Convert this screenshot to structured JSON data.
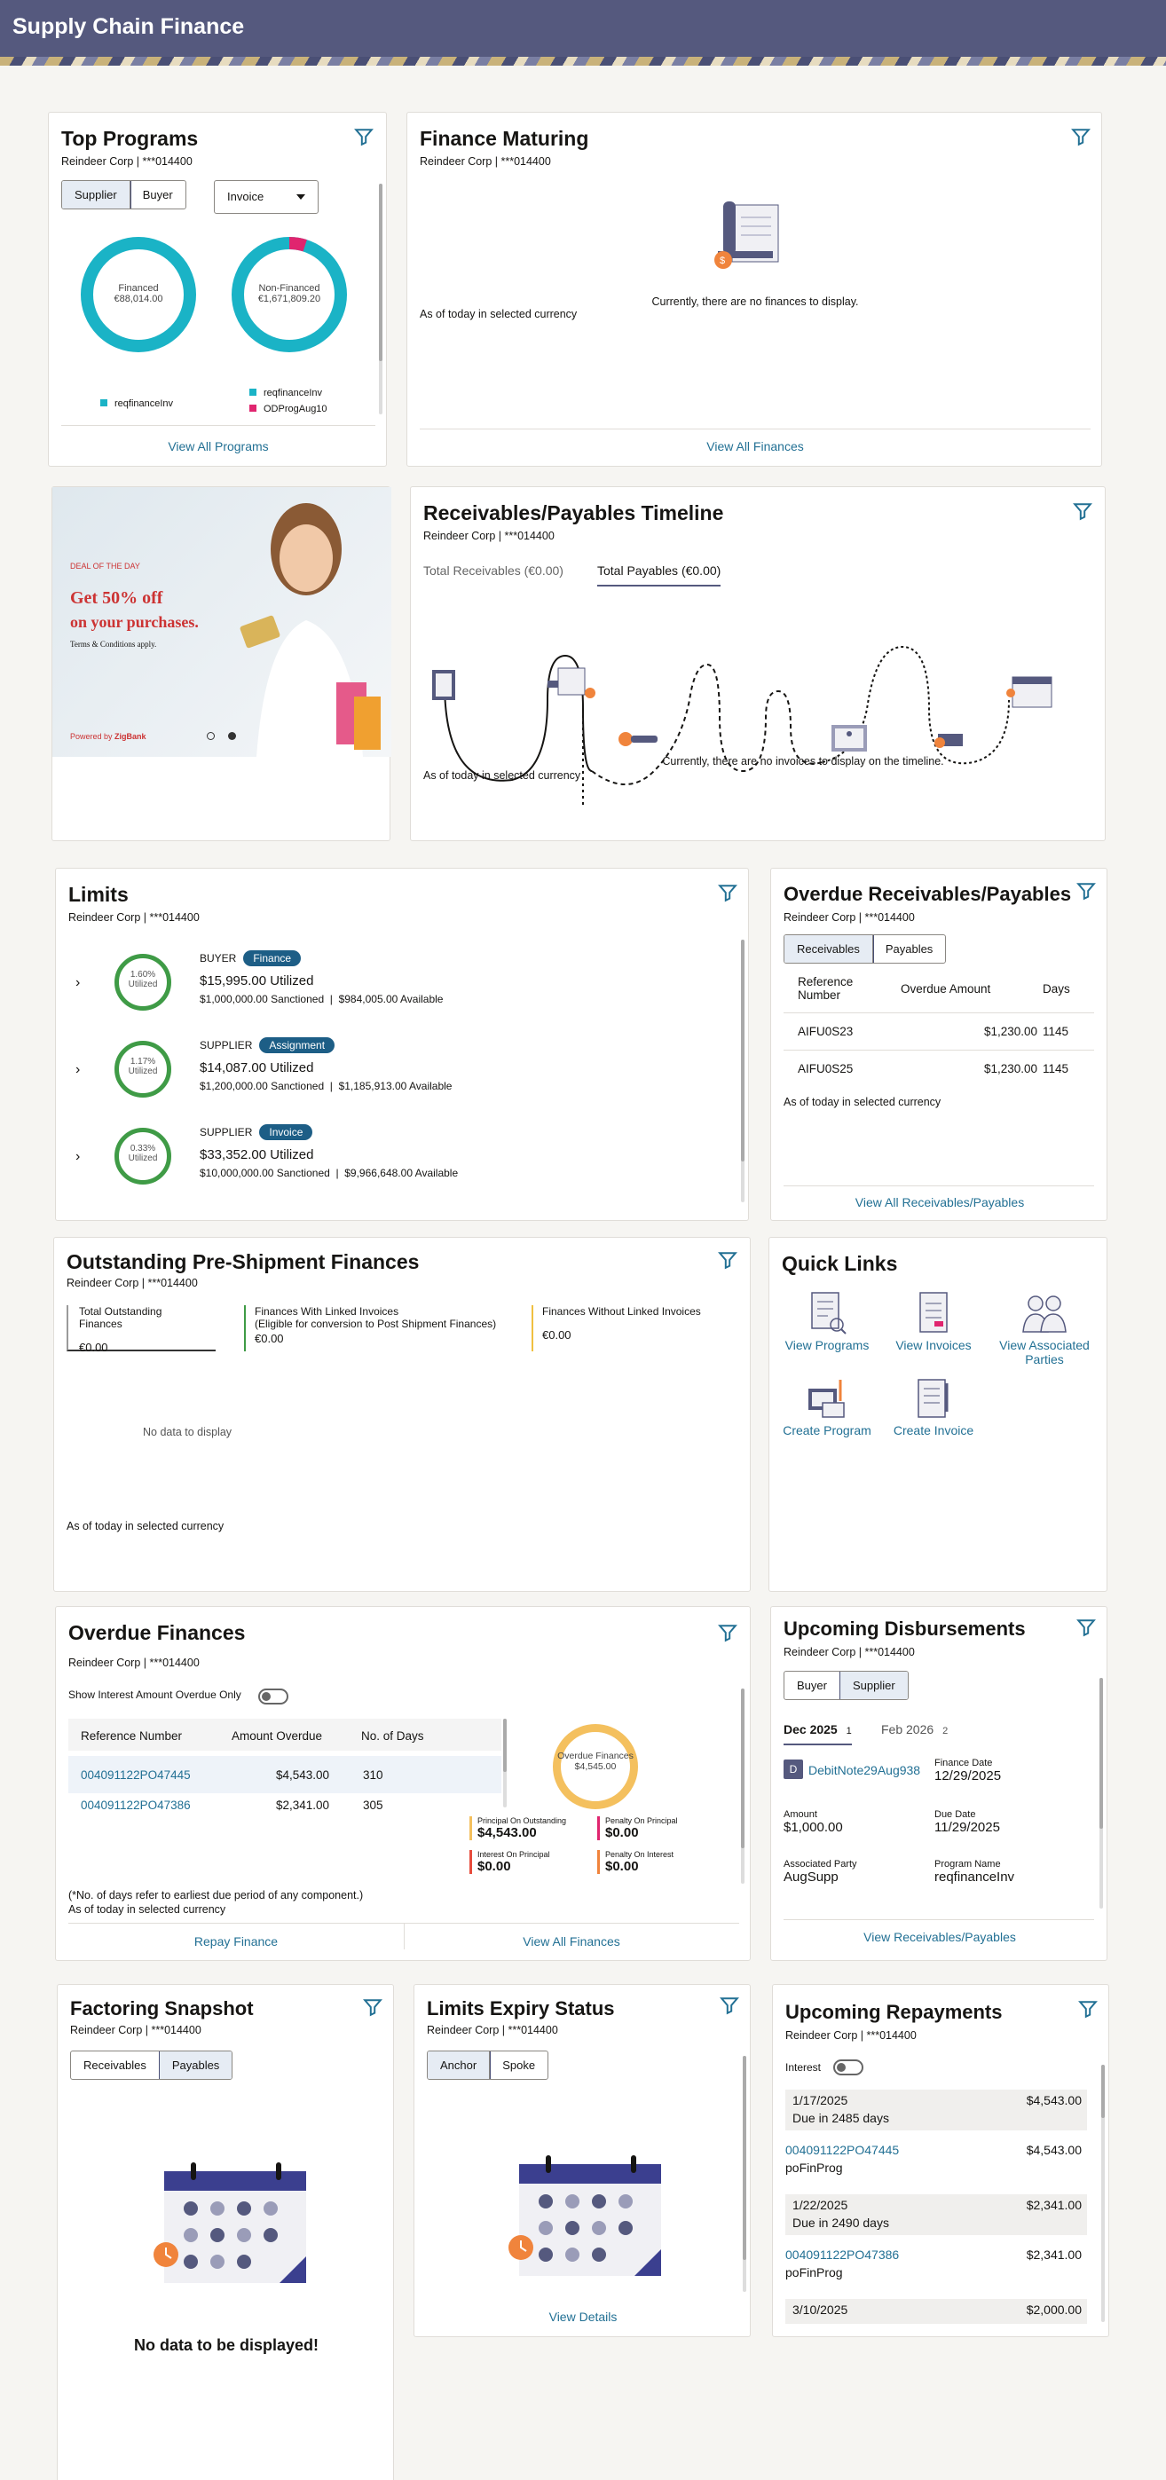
{
  "header": {
    "title": "Supply Chain Finance"
  },
  "common": {
    "org": "Reindeer Corp | ***014400",
    "asof": "As of today in selected currency"
  },
  "top_programs": {
    "title": "Top Programs",
    "tabs": [
      "Supplier",
      "Buyer"
    ],
    "select": "Invoice",
    "donut1": {
      "label": "Financed",
      "value": "€88,014.00"
    },
    "donut2": {
      "label": "Non-Financed",
      "value": "€1,671,809.20"
    },
    "legend1": "reqfinanceInv",
    "legend2a": "reqfinanceInv",
    "legend2b": "ODProgAug10",
    "link": "View All Programs",
    "colors": {
      "teal": "#1ab3c6",
      "pink": "#e0256f"
    }
  },
  "finance_maturing": {
    "title": "Finance Maturing",
    "empty": "Currently, there are no finances to display.",
    "link": "View All Finances"
  },
  "promo": {
    "deal": "DEAL OF THE DAY",
    "headline1": "Get 50% off",
    "headline2": "on your purchases.",
    "terms": "Terms & Conditions apply.",
    "powered": "Powered by",
    "brand": "ZigBank"
  },
  "timeline": {
    "title": "Receivables/Payables Timeline",
    "tab1": "Total Receivables (€0.00)",
    "tab2": "Total Payables (€0.00)",
    "empty": "Currently, there are no invoices to display on the timeline."
  },
  "limits": {
    "title": "Limits",
    "rows": [
      {
        "role": "BUYER",
        "type": "Finance",
        "pct": "1.60%",
        "util_label": "Utilized",
        "utilized": "$15,995.00 Utilized",
        "sanctioned": "$1,000,000.00 Sanctioned",
        "available": "$984,005.00 Available"
      },
      {
        "role": "SUPPLIER",
        "type": "Assignment",
        "pct": "1.17%",
        "util_label": "Utilized",
        "utilized": "$14,087.00 Utilized",
        "sanctioned": "$1,200,000.00 Sanctioned",
        "available": "$1,185,913.00 Available"
      },
      {
        "role": "SUPPLIER",
        "type": "Invoice",
        "pct": "0.33%",
        "util_label": "Utilized",
        "utilized": "$33,352.00 Utilized",
        "sanctioned": "$10,000,000.00 Sanctioned",
        "available": "$9,966,648.00 Available"
      }
    ]
  },
  "overdue_rp": {
    "title": "Overdue Receivables/Payables",
    "tabs": [
      "Receivables",
      "Payables"
    ],
    "headers": [
      "Reference Number",
      "Overdue Amount",
      "Days"
    ],
    "rows": [
      [
        "AIFU0S23",
        "$1,230.00",
        "1145"
      ],
      [
        "AIFU0S25",
        "$1,230.00",
        "1145"
      ]
    ],
    "link": "View All Receivables/Payables"
  },
  "preshipment": {
    "title": "Outstanding Pre-Shipment Finances",
    "c1_label": "Total Outstanding Finances",
    "c1_value": "€0.00",
    "c2_label": "Finances With Linked Invoices",
    "c2_sub": "(Eligible for conversion to Post Shipment Finances)",
    "c2_value": "€0.00",
    "c3_label": "Finances Without Linked Invoices",
    "c3_value": "€0.00",
    "empty": "No data to display"
  },
  "quick_links": {
    "title": "Quick Links",
    "items": [
      "View Programs",
      "View Invoices",
      "View Associated Parties",
      "Create Program",
      "Create Invoice"
    ]
  },
  "overdue_fin": {
    "title": "Overdue Finances",
    "toggle": "Show Interest Amount Overdue Only",
    "headers": [
      "Reference Number",
      "Amount Overdue",
      "No. of Days"
    ],
    "rows": [
      [
        "004091122PO47445",
        "$4,543.00",
        "310"
      ],
      [
        "004091122PO47386",
        "$2,341.00",
        "305"
      ]
    ],
    "donut_label": "Overdue Finances",
    "donut_value": "$4,545.00",
    "legend": [
      {
        "label": "Principal On Outstanding",
        "value": "$4,543.00"
      },
      {
        "label": "Penalty On Principal",
        "value": "$0.00"
      },
      {
        "label": "Interest On Principal",
        "value": "$0.00"
      },
      {
        "label": "Penalty On Interest",
        "value": "$0.00"
      }
    ],
    "note": "(*No. of days refer to earliest due period of any component.)",
    "repay": "Repay Finance",
    "viewall": "View All Finances"
  },
  "disbursements": {
    "title": "Upcoming Disbursements",
    "tabs": [
      "Buyer",
      "Supplier"
    ],
    "month1": "Dec 2025",
    "count1": "1",
    "month2": "Feb 2026",
    "count2": "2",
    "ref": "DebitNote29Aug938",
    "badge": "D",
    "fields": [
      {
        "label": "Finance Date",
        "value": "12/29/2025"
      },
      {
        "label": "Amount",
        "value": "$1,000.00"
      },
      {
        "label": "Due Date",
        "value": "11/29/2025"
      },
      {
        "label": "Associated Party",
        "value": "AugSupp"
      },
      {
        "label": "Program Name",
        "value": "reqfinanceInv"
      }
    ],
    "link": "View Receivables/Payables"
  },
  "factoring": {
    "title": "Factoring Snapshot",
    "tabs": [
      "Receivables",
      "Payables"
    ],
    "empty": "No data to be displayed!"
  },
  "limits_expiry": {
    "title": "Limits Expiry Status",
    "tabs": [
      "Anchor",
      "Spoke"
    ],
    "link": "View Details"
  },
  "repayments": {
    "title": "Upcoming Repayments",
    "toggle": "Interest",
    "groups": [
      {
        "date": "1/17/2025",
        "due": "Due in 2485 days",
        "total": "$4,543.00",
        "ref": "004091122PO47445",
        "prog": "poFinProg",
        "amount": "$4,543.00"
      },
      {
        "date": "1/22/2025",
        "due": "Due in 2490 days",
        "total": "$2,341.00",
        "ref": "004091122PO47386",
        "prog": "poFinProg",
        "amount": "$2,341.00"
      },
      {
        "date": "3/10/2025",
        "due": "",
        "total": "$2,000.00"
      }
    ]
  }
}
